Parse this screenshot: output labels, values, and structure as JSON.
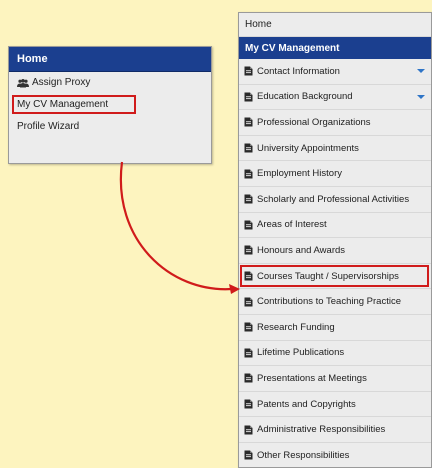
{
  "left_menu": {
    "header": "Home",
    "items": [
      {
        "label": "Assign Proxy",
        "icon": "users-icon"
      },
      {
        "label": "My CV Management",
        "highlighted": true
      },
      {
        "label": "Profile Wizard"
      }
    ]
  },
  "right_menu": {
    "home": "Home",
    "title": "My CV Management",
    "items": [
      {
        "label": "Contact Information",
        "expandable": true
      },
      {
        "label": "Education Background",
        "expandable": true
      },
      {
        "label": "Professional Organizations"
      },
      {
        "label": "University Appointments"
      },
      {
        "label": "Employment History"
      },
      {
        "label": "Scholarly and Professional Activities"
      },
      {
        "label": "Areas of Interest"
      },
      {
        "label": "Honours and Awards"
      },
      {
        "label": "Courses Taught / Supervisorships",
        "highlighted": true
      },
      {
        "label": "Contributions to Teaching Practice"
      },
      {
        "label": "Research Funding"
      },
      {
        "label": "Lifetime Publications"
      },
      {
        "label": "Presentations at Meetings"
      },
      {
        "label": "Patents and Copyrights"
      },
      {
        "label": "Administrative Responsibilities"
      },
      {
        "label": "Other Responsibilities"
      }
    ]
  },
  "colors": {
    "background": "#fdf4bf",
    "header_blue": "#1b3f8f",
    "highlight_red": "#d01b1b",
    "caret_blue": "#2f75c7"
  }
}
